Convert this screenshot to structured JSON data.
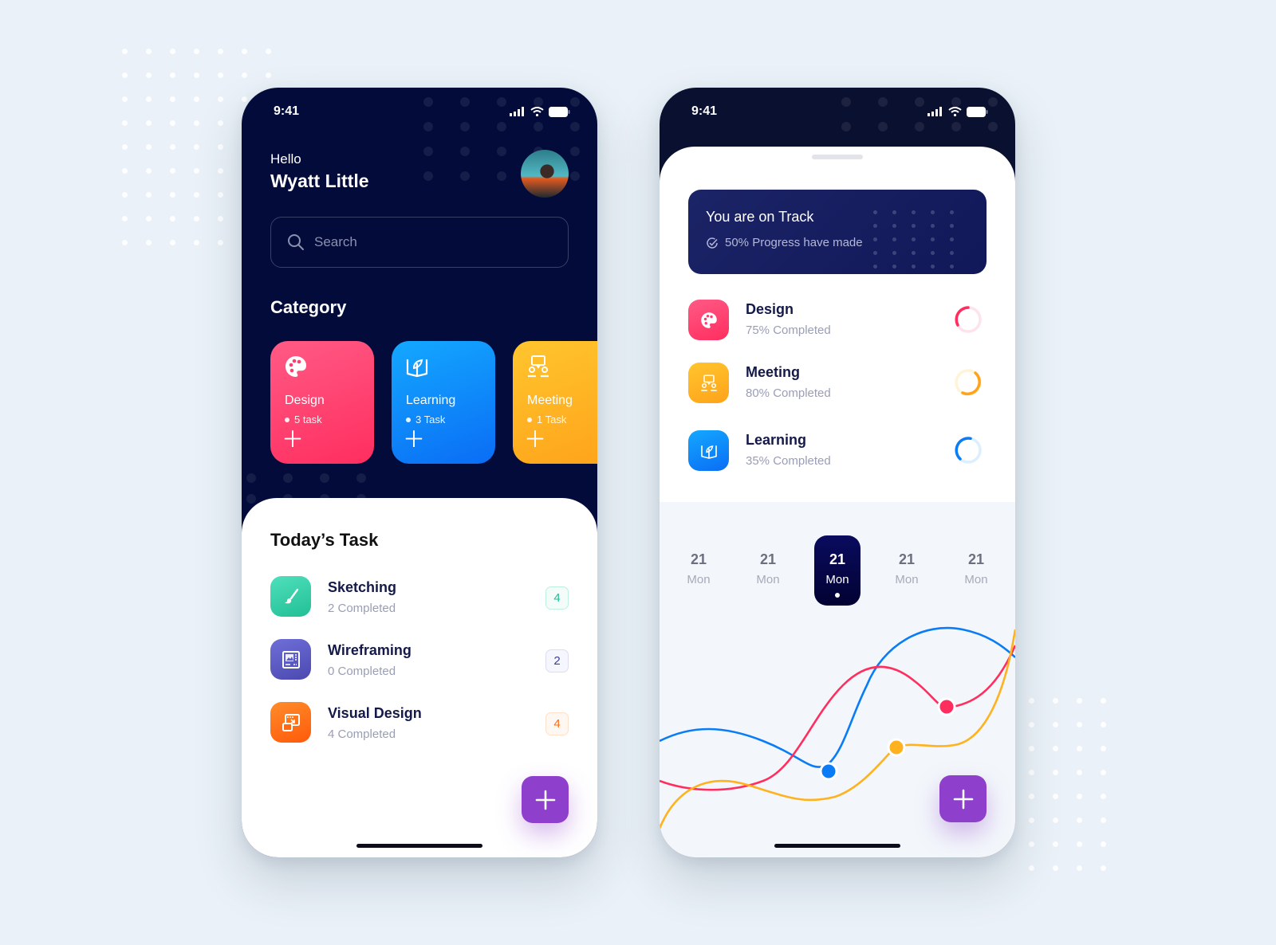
{
  "colors": {
    "navy": "#020b3a",
    "pink": "#ff3d6e",
    "blue": "#0a7cf5",
    "orange": "#ffb21e",
    "purple": "#8e3fcc",
    "teal": "#2fc8a0",
    "indigo": "#5b5bc4",
    "deep_orange": "#ff6a10"
  },
  "home_screen": {
    "status_time": "9:41",
    "greeting": "Hello",
    "user_name": "Wyatt Little",
    "search_placeholder": "Search",
    "category_title": "Category",
    "categories": [
      {
        "name": "Design",
        "count": "5 task",
        "icon": "palette-icon"
      },
      {
        "name": "Learning",
        "count": "3 Task",
        "icon": "book-leaf-icon"
      },
      {
        "name": "Meeting",
        "count": "1 Task",
        "icon": "meeting-icon"
      }
    ],
    "todays_task_title": "Today’s Task",
    "tasks": [
      {
        "name": "Sketching",
        "sub": "2 Completed",
        "badge": "4",
        "icon": "brush-icon"
      },
      {
        "name": "Wireframing",
        "sub": "0 Completed",
        "badge": "2",
        "icon": "wireframe-icon"
      },
      {
        "name": "Visual Design",
        "sub": "4 Completed",
        "badge": "4",
        "icon": "visual-design-icon"
      }
    ],
    "fab_label": "+"
  },
  "progress_screen": {
    "status_time": "9:41",
    "track_title": "You are on Track",
    "track_subtitle": "50% Progress have made",
    "progress_items": [
      {
        "name": "Design",
        "sub": "75% Completed",
        "percent": 75,
        "icon": "palette-icon"
      },
      {
        "name": "Meeting",
        "sub": "80% Completed",
        "percent": 80,
        "icon": "meeting-icon"
      },
      {
        "name": "Learning",
        "sub": "35% Completed",
        "percent": 35,
        "icon": "book-leaf-icon"
      }
    ],
    "days": [
      {
        "num": "21",
        "dow": "Mon",
        "active": false
      },
      {
        "num": "21",
        "dow": "Mon",
        "active": false
      },
      {
        "num": "21",
        "dow": "Mon",
        "active": true
      },
      {
        "num": "21",
        "dow": "Mon",
        "active": false
      },
      {
        "num": "21",
        "dow": "Mon",
        "active": false
      }
    ],
    "fab_label": "+"
  }
}
